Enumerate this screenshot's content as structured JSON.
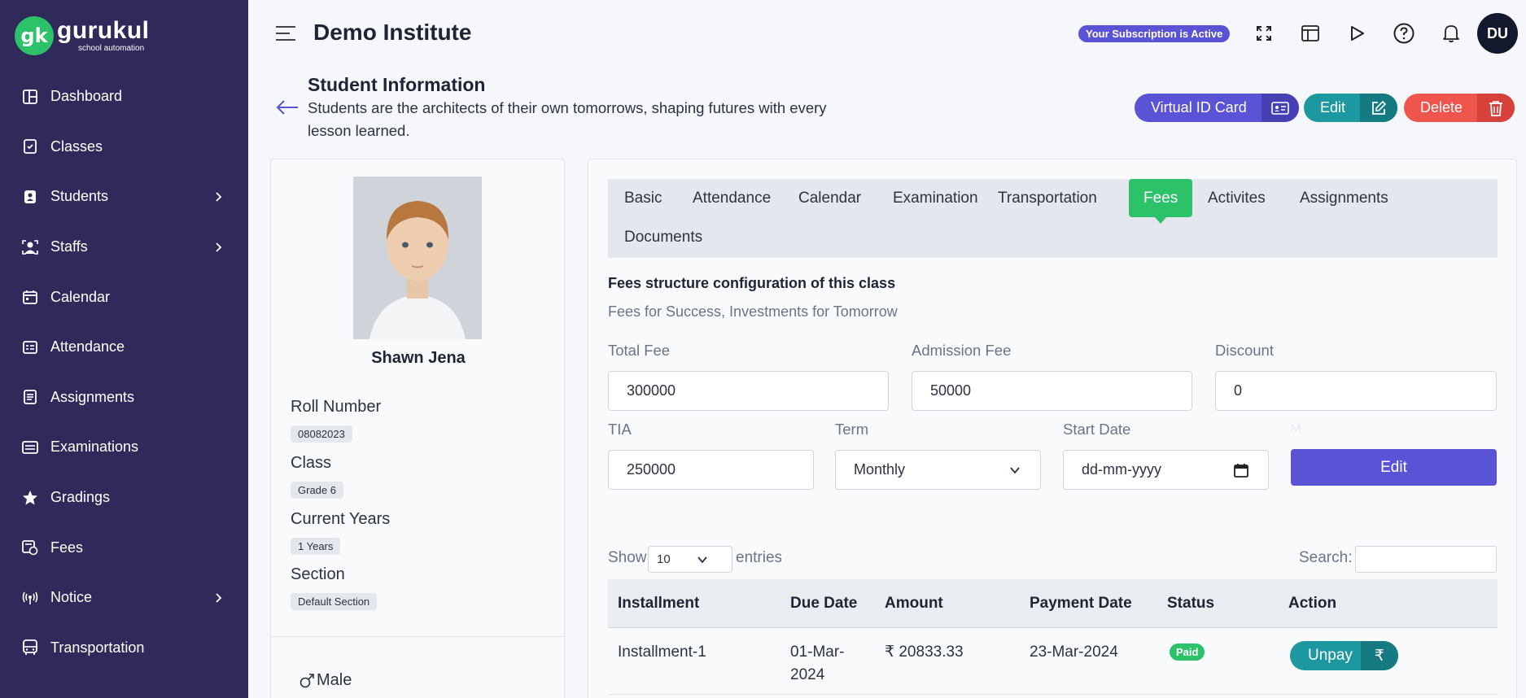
{
  "brand": {
    "mark": "gk",
    "name": "gurukul",
    "tagline": "school automation"
  },
  "sidebar": {
    "items": [
      {
        "label": "Dashboard",
        "icon": "dashboard-icon"
      },
      {
        "label": "Classes",
        "icon": "classes-icon"
      },
      {
        "label": "Students",
        "icon": "students-icon",
        "has_children": true
      },
      {
        "label": "Staffs",
        "icon": "staffs-icon",
        "has_children": true
      },
      {
        "label": "Calendar",
        "icon": "calendar-icon"
      },
      {
        "label": "Attendance",
        "icon": "attendance-icon"
      },
      {
        "label": "Assignments",
        "icon": "assignments-icon"
      },
      {
        "label": "Examinations",
        "icon": "examinations-icon"
      },
      {
        "label": "Gradings",
        "icon": "star-icon"
      },
      {
        "label": "Fees",
        "icon": "fees-icon"
      },
      {
        "label": "Notice",
        "icon": "broadcast-icon",
        "has_children": true
      },
      {
        "label": "Transportation",
        "icon": "bus-icon"
      }
    ]
  },
  "header": {
    "title": "Demo Institute",
    "subscription": "Your Subscription is Active",
    "user_initials": "DU"
  },
  "page": {
    "title": "Student Information",
    "subtitle": "Students are the architects of their own tomorrows, shaping futures with every lesson learned.",
    "buttons": {
      "virtual_id": "Virtual ID Card",
      "edit": "Edit",
      "delete": "Delete"
    }
  },
  "student": {
    "name": "Shawn Jena",
    "roll_label": "Roll Number",
    "roll": "08082023",
    "class_label": "Class",
    "class": "Grade 6",
    "years_label": "Current Years",
    "years": "1 Years",
    "section_label": "Section",
    "section": "Default Section",
    "gender": "Male"
  },
  "tabs": [
    "Basic",
    "Attendance",
    "Calendar",
    "Examination",
    "Transportation",
    "Fees",
    "Activites",
    "Assignments",
    "Documents"
  ],
  "active_tab": "Fees",
  "fees": {
    "title": "Fees structure configuration of this class",
    "subtitle": "Fees for Success, Investments for Tomorrow",
    "total_fee_label": "Total Fee",
    "total_fee": "300000",
    "admission_fee_label": "Admission Fee",
    "admission_fee": "50000",
    "discount_label": "Discount",
    "discount": "0",
    "tia_label": "TIA",
    "tia": "250000",
    "term_label": "Term",
    "term": "Monthly",
    "start_date_label": "Start Date",
    "start_date_placeholder": "dd-mm-yyyy",
    "faint_label": "M",
    "edit_button": "Edit"
  },
  "table": {
    "show_label": "Show",
    "page_size": "10",
    "entries_label": "entries",
    "search_label": "Search:",
    "columns": [
      "Installment",
      "Due Date",
      "Amount",
      "Payment Date",
      "Status",
      "Action"
    ],
    "rows": [
      {
        "installment": "Installment-1",
        "due_date": "01-Mar-2024",
        "amount": "₹ 20833.33",
        "payment_date": "23-Mar-2024",
        "status": "Paid",
        "action": "Unpay",
        "action_icon": "₹"
      }
    ]
  },
  "colors": {
    "sidebar": "#302a5a",
    "accent": "#5b53d6",
    "success": "#2bc26a",
    "teal": "#1e98a0",
    "danger": "#f0554d"
  }
}
